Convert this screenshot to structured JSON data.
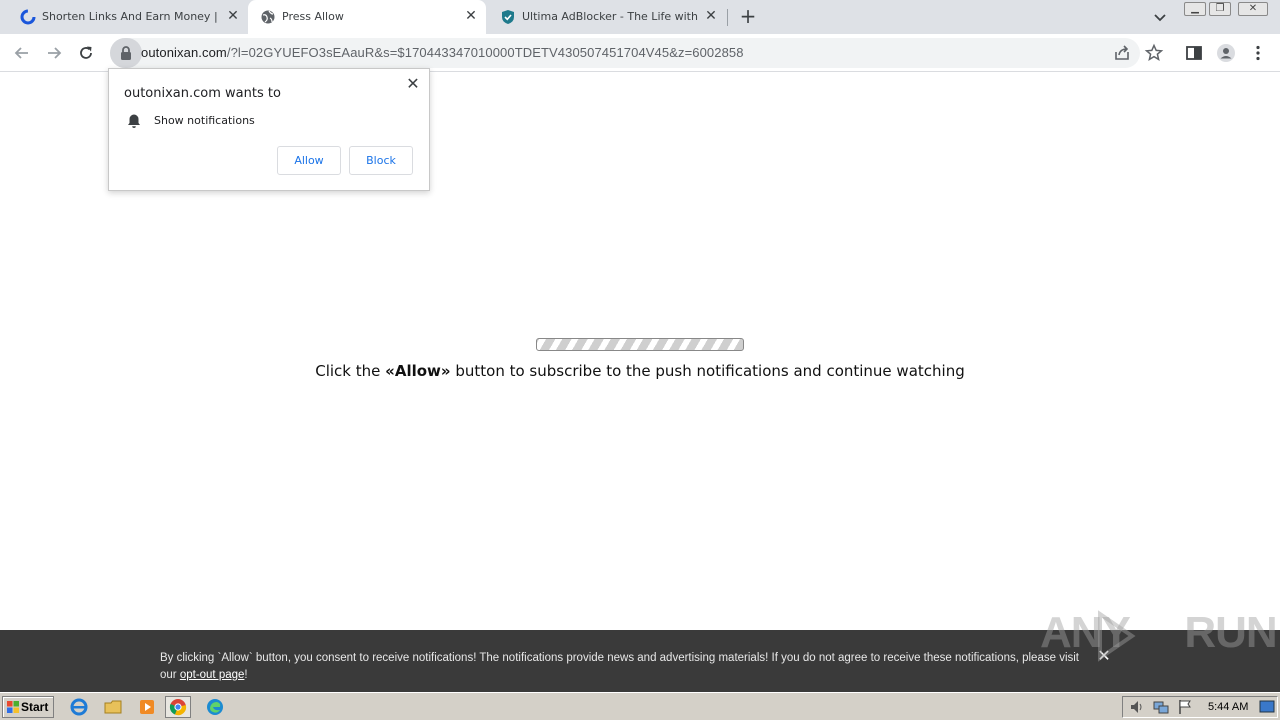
{
  "tabs": [
    {
      "title": "Shorten Links And Earn Money | cuty",
      "favicon": "cuty-favicon",
      "active": false
    },
    {
      "title": "Press Allow",
      "favicon": "globe-icon",
      "active": true
    },
    {
      "title": "Ultima AdBlocker - The Life without A",
      "favicon": "shield-icon",
      "active": false
    }
  ],
  "new_tab_label": "+",
  "url": {
    "host": "outonixan.com",
    "path": "/?l=02GYUEFO3sEAauR&s=$170443347010000TDETV430507451704V45&z=6002858"
  },
  "permission_popup": {
    "title": "outonixan.com wants to",
    "description": "Show notifications",
    "allow_label": "Allow",
    "block_label": "Block",
    "close_glyph": "✕"
  },
  "page": {
    "message_before": "Click the ",
    "message_bold": "«Allow»",
    "message_after": " button to subscribe to the push notifications and continue watching"
  },
  "consent_bar": {
    "text": "By clicking `Allow` button, you consent to receive notifications! The notifications provide news and advertising materials! If you do not agree to receive these notifications, please visit our ",
    "link_text": "opt-out page",
    "text_end": "!",
    "close_glyph": "✕"
  },
  "watermark": {
    "left": "ANY",
    "right": "RUN"
  },
  "taskbar": {
    "start_label": "Start",
    "clock": "5:44 AM"
  },
  "colors": {
    "accent": "#1a73e8",
    "consent_bg": "#3a3a3a",
    "tabstrip_bg": "#dee1e6"
  }
}
